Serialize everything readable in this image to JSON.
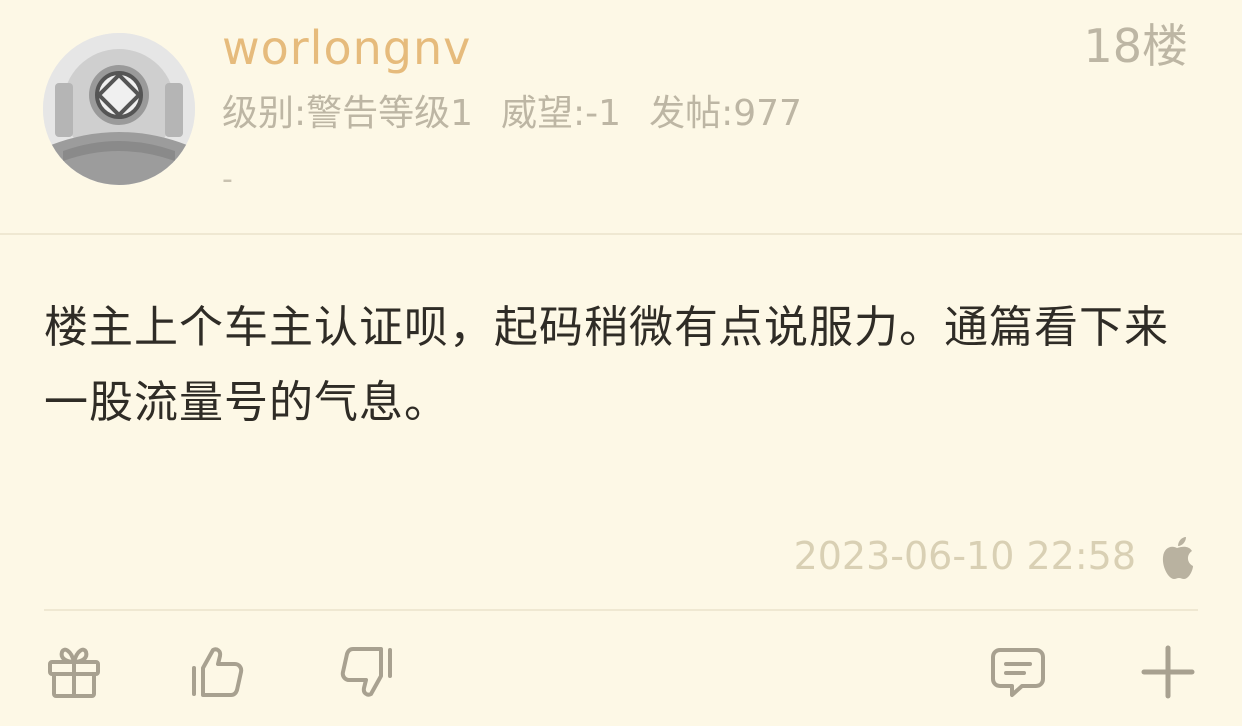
{
  "user": {
    "name": "worlongnv",
    "level": "级别:警告等级1",
    "reputation": "威望:-1",
    "posts": "发帖:977",
    "signature": "-"
  },
  "floor_label": "18楼",
  "post": {
    "text": "楼主上个车主认证呗，起码稍微有点说服力。通篇看下来一股流量号的气息。",
    "timestamp": "2023-06-10 22:58",
    "device_icon": "apple-icon"
  },
  "actions": [
    {
      "name": "gift",
      "icon": "gift-icon"
    },
    {
      "name": "like",
      "icon": "thumbs-up-icon"
    },
    {
      "name": "dislike",
      "icon": "thumbs-down-icon"
    },
    {
      "name": "comment",
      "icon": "comment-icon"
    },
    {
      "name": "more",
      "icon": "plus-icon"
    }
  ],
  "colors": {
    "background": "#fdf8e6",
    "username": "#e6bb7c",
    "meta_text": "#bdb6a4",
    "body_text": "#2f2c26",
    "icon": "#a8a190"
  }
}
